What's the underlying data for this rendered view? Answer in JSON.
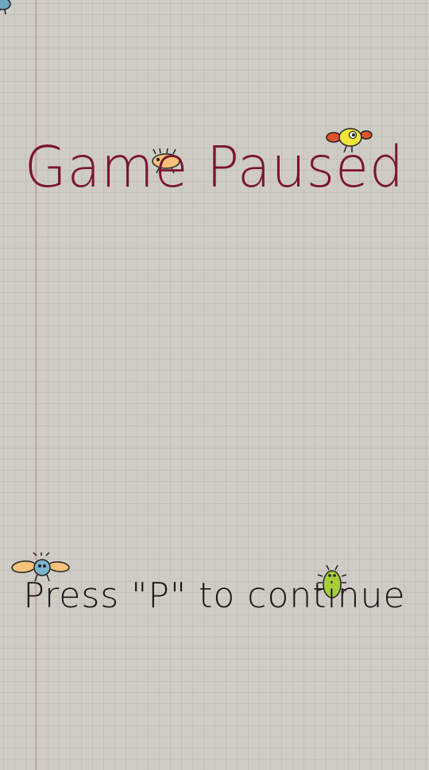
{
  "pause_screen": {
    "title": "Game Paused",
    "prompt": "Press \"P\" to continue"
  },
  "colors": {
    "title": "#7a1530",
    "prompt": "#141414",
    "paper": "#cfccc6",
    "margin_line": "#be8c82"
  },
  "sprites": [
    {
      "name": "blue-bug-sprite-corner"
    },
    {
      "name": "orange-bug-sprite"
    },
    {
      "name": "yellow-bird-sprite"
    },
    {
      "name": "winged-blue-bug-sprite"
    },
    {
      "name": "green-bug-sprite"
    }
  ]
}
